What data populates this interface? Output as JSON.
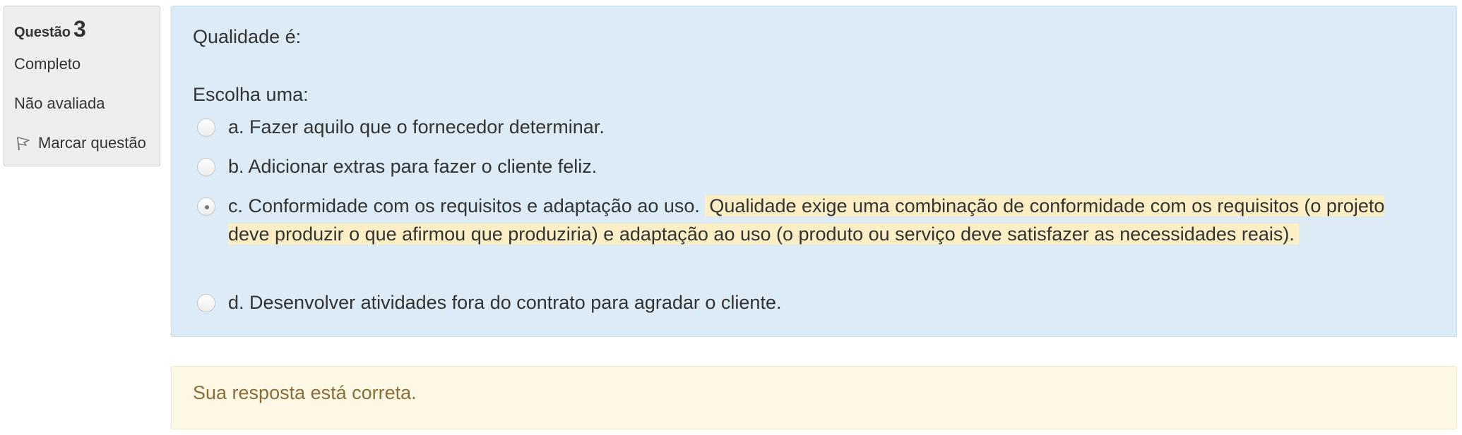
{
  "info": {
    "question_label": "Questão",
    "question_number": "3",
    "state": "Completo",
    "grade": "Não avaliada",
    "flag_label": "Marcar questão"
  },
  "question": {
    "text": "Qualidade é:",
    "prompt": "Escolha uma:",
    "answers": [
      {
        "label": "a. Fazer aquilo que o fornecedor determinar.",
        "selected": false
      },
      {
        "label": "b. Adicionar extras para fazer o cliente feliz.",
        "selected": false
      },
      {
        "label": "c. Conformidade com os requisitos e adaptação ao uso.",
        "selected": true,
        "feedback": "Qualidade exige uma combinação de conformidade com os requisitos (o projeto deve produzir o que afirmou que produziria) e adaptação ao uso (o produto ou serviço deve satisfazer as necessidades reais)."
      },
      {
        "label": "d. Desenvolver atividades fora do contrato para agradar o cliente.",
        "selected": false
      }
    ]
  },
  "outcome": {
    "text": "Sua resposta está correta."
  },
  "colors": {
    "formulation_bg": "#dcebf5",
    "outcome_bg": "#fcf8e3",
    "outcome_text": "#8a6d3b",
    "feedback_highlight": "#fcefc6"
  }
}
